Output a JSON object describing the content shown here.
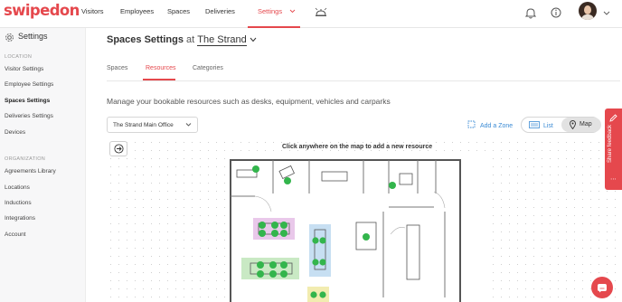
{
  "brand": {
    "logo_text": "swipedon",
    "accent": "#e5484d",
    "link": "#3b8bd4"
  },
  "topnav": {
    "items": [
      {
        "label": "Visitors"
      },
      {
        "label": "Employees"
      },
      {
        "label": "Spaces"
      },
      {
        "label": "Deliveries"
      },
      {
        "label": "Settings",
        "active": true
      }
    ],
    "icons": [
      "reception-bell-icon",
      "notification-bell-icon",
      "info-icon",
      "avatar",
      "chevron-down-icon"
    ]
  },
  "sidebar": {
    "title": "Settings",
    "sections": [
      {
        "heading": "LOCATION",
        "items": [
          "Visitor Settings",
          "Employee Settings",
          "Spaces Settings",
          "Deliveries Settings",
          "Devices"
        ],
        "active": "Spaces Settings"
      },
      {
        "heading": "ORGANIZATION",
        "items": [
          "Agreements Library",
          "Locations",
          "Inductions",
          "Integrations",
          "Account"
        ]
      }
    ]
  },
  "page": {
    "title": "Spaces Settings",
    "at": "at",
    "location": "The Strand",
    "tabs": [
      "Spaces",
      "Resources",
      "Categories"
    ],
    "active_tab": "Resources",
    "description": "Manage your bookable resources such as desks, equipment, vehicles and carparks",
    "dropdown_value": "The Strand Main Office",
    "add_zone": "Add a Zone",
    "view_list": "List",
    "view_map": "Map",
    "map_hint": "Click anywhere on the map to add a new resource"
  },
  "feedback": {
    "label": "Share feedback"
  }
}
